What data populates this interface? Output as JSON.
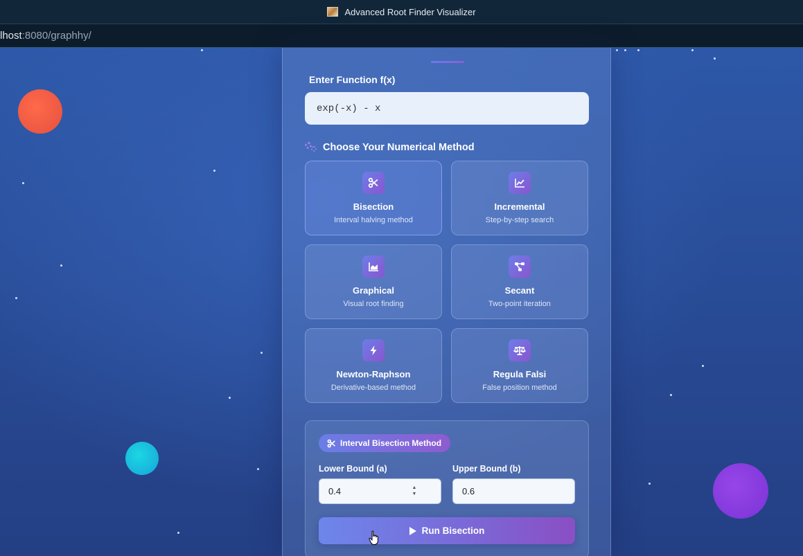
{
  "window": {
    "title": "Advanced Root Finder Visualizer"
  },
  "address_bar": {
    "host": "lhost",
    "rest": ":8080/graphhy/"
  },
  "function_section": {
    "label": "Enter Function f(x)",
    "value": "exp(-x) - x"
  },
  "methods_section": {
    "heading": "Choose Your Numerical Method",
    "icon": "gears-icon",
    "methods": [
      {
        "name": "Bisection",
        "desc": "Interval halving method",
        "icon": "scissors-icon",
        "selected": true
      },
      {
        "name": "Incremental",
        "desc": "Step-by-step search",
        "icon": "line-chart-icon",
        "selected": false
      },
      {
        "name": "Graphical",
        "desc": "Visual root finding",
        "icon": "area-chart-icon",
        "selected": false
      },
      {
        "name": "Secant",
        "desc": "Two-point iteration",
        "icon": "nodes-icon",
        "selected": false
      },
      {
        "name": "Newton-Raphson",
        "desc": "Derivative-based method",
        "icon": "bolt-icon",
        "selected": false
      },
      {
        "name": "Regula Falsi",
        "desc": "False position method",
        "icon": "scale-icon",
        "selected": false
      }
    ]
  },
  "params": {
    "badge": "Interval Bisection Method",
    "lower_label": "Lower Bound (a)",
    "lower_value": "0.4",
    "upper_label": "Upper Bound (b)",
    "upper_value": "0.6",
    "run_label": "Run Bisection"
  },
  "colors": {
    "accent_start": "#6b7ee8",
    "accent_end": "#8a55cf",
    "background": "#2a4f99"
  }
}
